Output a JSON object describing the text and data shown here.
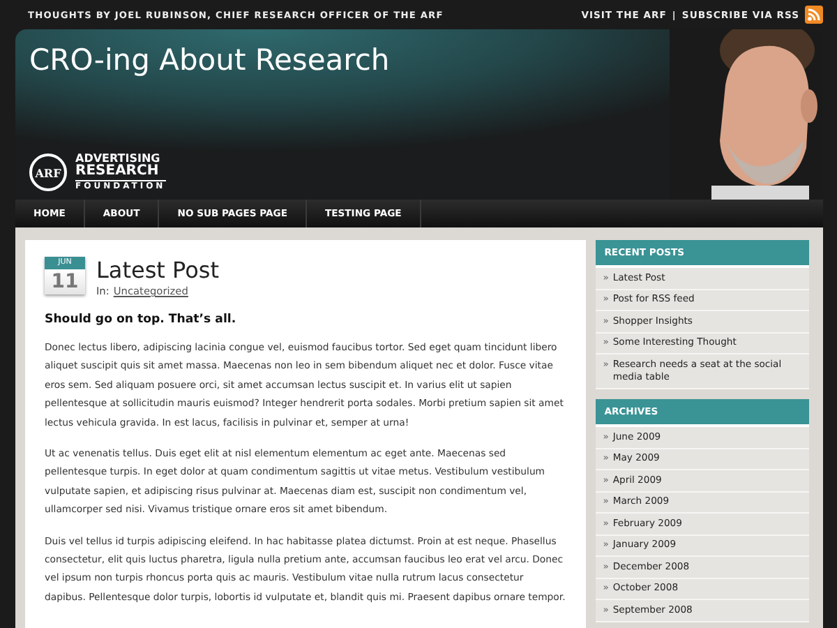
{
  "top_bar": {
    "tagline": "THOUGHTS BY JOEL RUBINSON, CHIEF RESEARCH OFFICER OF THE ARF",
    "links": [
      {
        "label": "VISIT THE ARF"
      },
      {
        "label": "SUBSCRIBE VIA RSS"
      }
    ],
    "separator": "|"
  },
  "header": {
    "title": "CRO-ing About Research",
    "logo": {
      "mark": "ARF",
      "lines": [
        "ADVERTISING",
        "RESEARCH",
        "FOUNDATION"
      ]
    }
  },
  "nav": [
    {
      "label": "HOME"
    },
    {
      "label": "ABOUT"
    },
    {
      "label": "NO SUB PAGES PAGE"
    },
    {
      "label": "TESTING PAGE"
    }
  ],
  "post": {
    "date": {
      "month": "JUN",
      "day": "11"
    },
    "title": "Latest Post",
    "category_prefix": "In:",
    "category": "Uncategorized",
    "lead": "Should go on top. That’s all.",
    "paragraphs": [
      "Donec lectus libero, adipiscing lacinia congue vel, euismod faucibus tortor. Sed eget quam tincidunt libero aliquet suscipit quis sit amet massa. Maecenas non leo in sem bibendum aliquet nec et dolor. Fusce vitae eros sem. Sed aliquam posuere orci, sit amet accumsan lectus suscipit et. In varius elit ut sapien pellentesque at sollicitudin mauris euismod? Integer hendrerit porta sodales. Morbi pretium sapien sit amet lectus vehicula gravida. In est lacus, facilisis in pulvinar et, semper at urna!",
      "Ut ac venenatis tellus. Duis eget elit at nisl elementum elementum ac eget ante. Maecenas sed pellentesque turpis. In eget dolor at quam condimentum sagittis ut vitae metus. Vestibulum vestibulum vulputate sapien, et adipiscing risus pulvinar at. Maecenas diam est, suscipit non condimentum vel, ullamcorper sed nisi. Vivamus tristique ornare eros sit amet bibendum.",
      "Duis vel tellus id turpis adipiscing eleifend. In hac habitasse platea dictumst. Proin at est neque. Phasellus consectetur, elit quis luctus pharetra, ligula nulla pretium ante, accumsan faucibus leo erat vel arcu. Donec vel ipsum non turpis rhoncus porta quis ac mauris. Vestibulum vitae nulla rutrum lacus consectetur dapibus. Pellentesque dolor turpis, lobortis id vulputate et, blandit quis mi. Praesent dapibus ornare tempor."
    ]
  },
  "sidebar": {
    "bullet": "»",
    "widgets": [
      {
        "title": "RECENT POSTS",
        "items": [
          "Latest Post",
          "Post for RSS feed",
          "Shopper Insights",
          "Some Interesting Thought",
          "Research needs a seat at the social media table"
        ]
      },
      {
        "title": "ARCHIVES",
        "items": [
          "June 2009",
          "May 2009",
          "April 2009",
          "March 2009",
          "February 2009",
          "January 2009",
          "December 2008",
          "October 2008",
          "September 2008"
        ]
      }
    ]
  }
}
